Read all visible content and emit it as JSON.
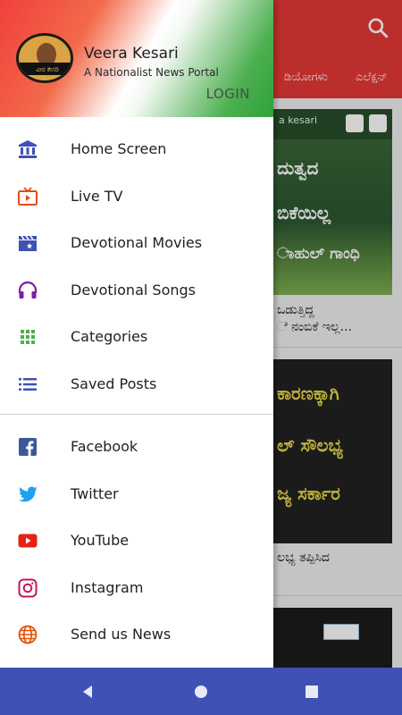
{
  "drawer": {
    "header": {
      "app_name": "Veera Kesari",
      "tagline": "A Nationalist News Portal",
      "login_label": "LOGIN",
      "logo_text": "ವೀರ ಕೇಸರಿ"
    },
    "menu": [
      {
        "label": "Home Screen",
        "icon": "bank-icon",
        "color": "#3f51b5"
      },
      {
        "label": "Live TV",
        "icon": "live-tv-icon",
        "color": "#e64a19"
      },
      {
        "label": "Devotional Movies",
        "icon": "movie-clapper-icon",
        "color": "#3f51b5"
      },
      {
        "label": "Devotional Songs",
        "icon": "headphones-icon",
        "color": "#7b1fa2"
      },
      {
        "label": "Categories",
        "icon": "grid-icon",
        "color": "#4caf50"
      },
      {
        "label": "Saved Posts",
        "icon": "list-icon",
        "color": "#3f51b5"
      }
    ],
    "social": [
      {
        "label": "Facebook",
        "icon": "facebook-icon",
        "color": "#3b5998"
      },
      {
        "label": "Twitter",
        "icon": "twitter-icon",
        "color": "#1da1f2"
      },
      {
        "label": "YouTube",
        "icon": "youtube-icon",
        "color": "#e62117"
      },
      {
        "label": "Instagram",
        "icon": "instagram-icon",
        "color": "#c2185b"
      },
      {
        "label": "Send us News",
        "icon": "globe-icon",
        "color": "#e65100"
      }
    ]
  },
  "background": {
    "tabs": [
      "ಡಿಯೋಗಳು",
      "ಎಲೆಕ್ಷನ್"
    ],
    "cards": [
      {
        "brand": "a kesari",
        "lines": [
          "ದುತ್ವದ",
          "ಬಿಕೆಯಿಲ್ಲ",
          "ಾಹುಲ್ ಗಾಂಧಿ"
        ],
        "caption": [
          "ಒಡುತ್ತಿದ್ದ",
          "ೆ ನಂಬಿಕೆ ಇಲ್ಲ..."
        ]
      },
      {
        "lines": [
          "ಕಾರಣಕ್ಕಾಗಿ",
          "ಲ್ ಸೌಲಭ್ಯ",
          "ಜ್ಯ ಸರ್ಕಾರ"
        ],
        "caption": [
          "ಲಭ್ಯ ತಪ್ಪಿಸಿದ"
        ]
      }
    ]
  },
  "navbar": {
    "back": "back-icon",
    "home": "home-icon",
    "recents": "recents-icon"
  },
  "colors": {
    "toolbar": "#e53935",
    "navbar": "#3f51b5"
  }
}
